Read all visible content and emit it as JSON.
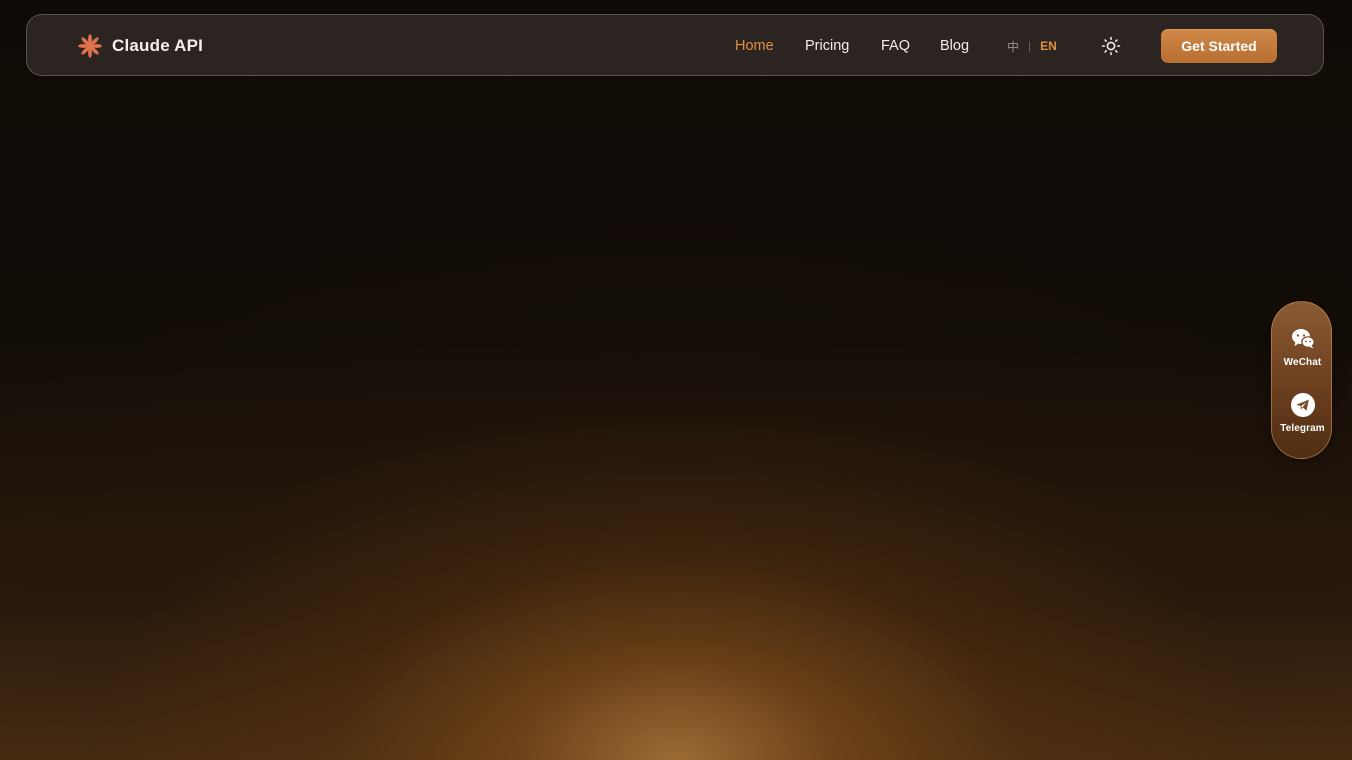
{
  "brand": {
    "name": "Claude API",
    "icon": "claude-asterisk-icon",
    "icon_color": "#e0734f"
  },
  "nav": {
    "items": [
      {
        "label": "Home",
        "active": true
      },
      {
        "label": "Pricing",
        "active": false
      },
      {
        "label": "FAQ",
        "active": false
      },
      {
        "label": "Blog",
        "active": false
      }
    ]
  },
  "language": {
    "zh": "中",
    "en": "EN",
    "selected": "EN"
  },
  "theme_toggle": {
    "icon": "sun-icon"
  },
  "cta": {
    "label": "Get Started"
  },
  "contacts": [
    {
      "label": "WeChat",
      "icon": "wechat-icon"
    },
    {
      "label": "Telegram",
      "icon": "telegram-icon"
    }
  ],
  "colors": {
    "accent": "#e09043",
    "cta": "#c57d3c",
    "background": "#120c08",
    "navbar": "#2b2420",
    "pill": "#7a4c28"
  }
}
